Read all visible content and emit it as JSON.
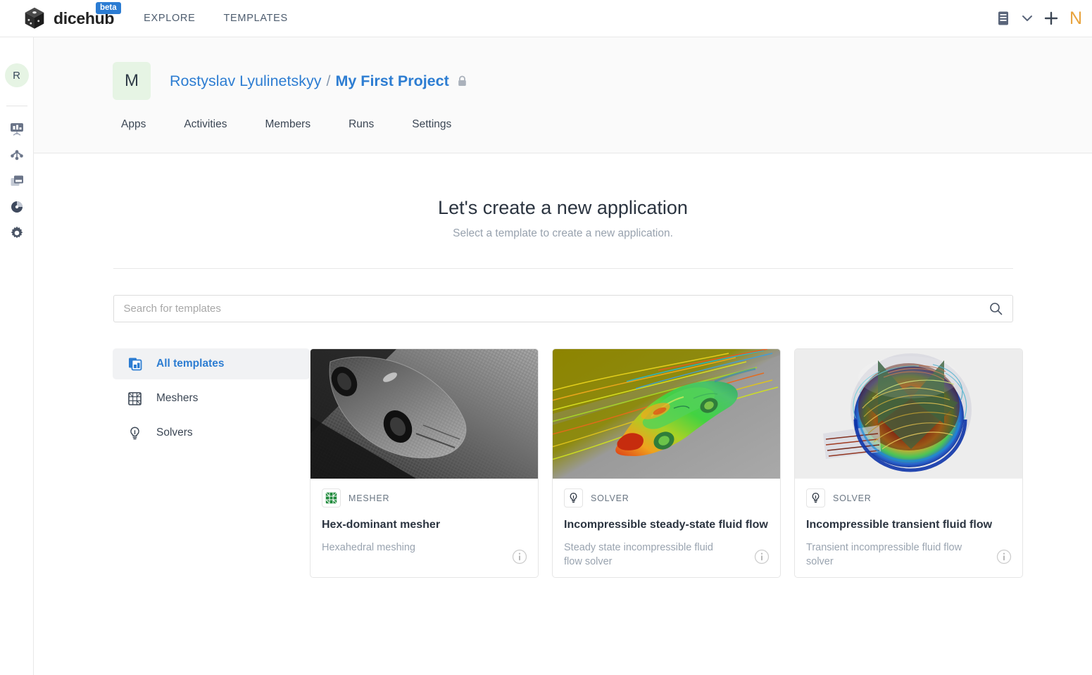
{
  "topbar": {
    "logo_text": "dicehub",
    "logo_icon": "cube-die-logo",
    "beta_badge": "beta",
    "nav": [
      {
        "label": "EXPLORE",
        "name": "explore"
      },
      {
        "label": "TEMPLATES",
        "name": "templates"
      }
    ],
    "right_icons": [
      {
        "name": "docs-book-icon"
      },
      {
        "name": "chevron-down-icon"
      },
      {
        "name": "plus-icon"
      }
    ],
    "user_initial": "N"
  },
  "rail": {
    "avatar_initial": "R",
    "items": [
      {
        "name": "dashboard-icon"
      },
      {
        "name": "network-nodes-icon"
      },
      {
        "name": "windows-copy-icon"
      },
      {
        "name": "pie-chart-icon"
      },
      {
        "name": "gear-icon"
      }
    ]
  },
  "project": {
    "avatar_initial": "M",
    "owner": "Rostyslav Lyulinetskyy",
    "separator": "/",
    "name": "My First Project",
    "visibility_icon": "lock-icon",
    "tabs": [
      {
        "label": "Apps"
      },
      {
        "label": "Activities"
      },
      {
        "label": "Members"
      },
      {
        "label": "Runs"
      },
      {
        "label": "Settings"
      }
    ]
  },
  "main": {
    "title": "Let's create a new application",
    "subtitle": "Select a template to create a new application.",
    "search": {
      "placeholder": "Search for templates",
      "value": "",
      "icon": "search-icon"
    },
    "filters": [
      {
        "label": "All templates",
        "icon": "documents-stack-icon",
        "active": true
      },
      {
        "label": "Meshers",
        "icon": "mesh-grid-icon",
        "active": false
      },
      {
        "label": "Solvers",
        "icon": "lightbulb-icon",
        "active": false
      }
    ],
    "cards": [
      {
        "badge": "MESHER",
        "badge_icon": "mesh-grid-icon-green",
        "title": "Hex-dominant mesher",
        "description": "Hexahedral meshing",
        "thumbnail": "grayscale-meshed-car",
        "info_icon": "info-circle-icon"
      },
      {
        "badge": "SOLVER",
        "badge_icon": "lightbulb-icon",
        "title": "Incompressible steady-state fluid flow",
        "description": "Steady state incompressible fluid flow solver",
        "thumbnail": "cfd-car-streamlines",
        "info_icon": "info-circle-icon"
      },
      {
        "badge": "SOLVER",
        "badge_icon": "lightbulb-icon",
        "title": "Incompressible transient fluid flow",
        "description": "Transient incompressible fluid flow solver",
        "thumbnail": "cfd-stirred-tank",
        "info_icon": "info-circle-icon"
      }
    ]
  },
  "colors": {
    "accent": "#2d7dd2",
    "badge_blue": "#2b7cd3",
    "avatar_green": "#e6f4e4",
    "text_dark": "#2b3440",
    "text_muted": "#9aa4b0"
  }
}
